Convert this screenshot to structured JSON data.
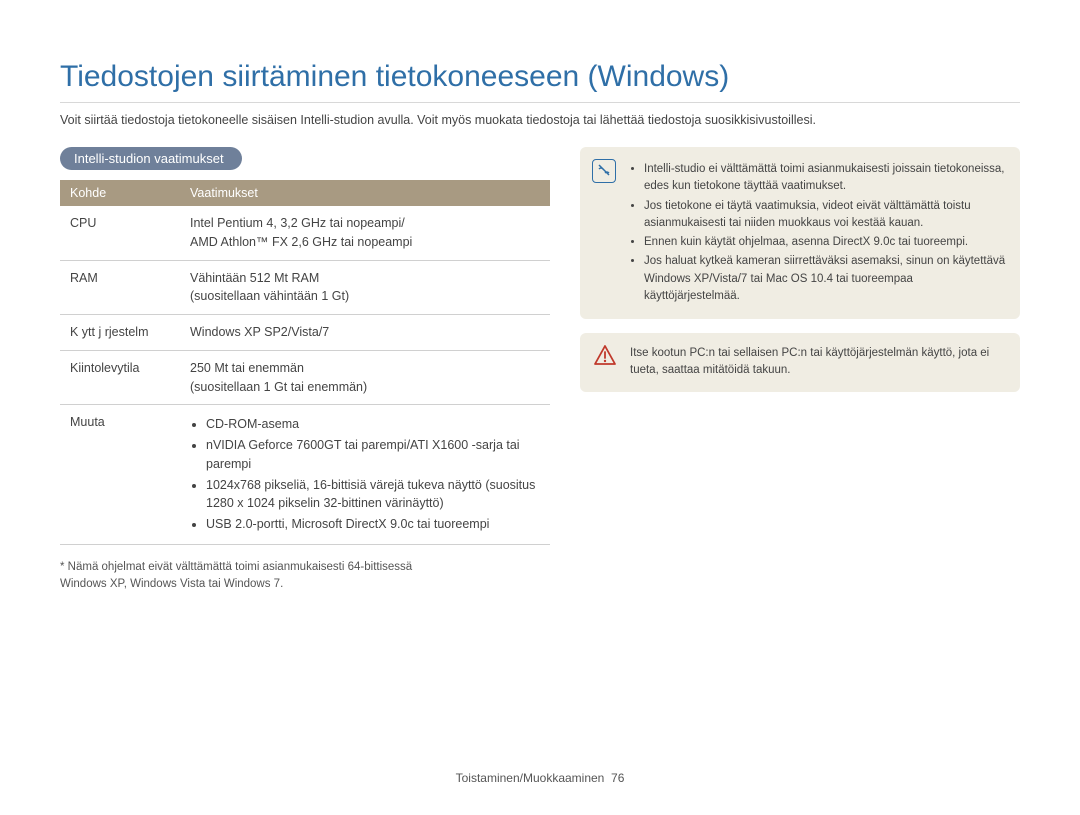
{
  "title": "Tiedostojen siirtäminen tietokoneeseen (Windows)",
  "intro": "Voit siirtää tiedostoja tietokoneelle sisäisen Intelli-studion avulla. Voit myös muokata tiedostoja tai lähettää tiedostoja suosikkisivustoillesi.",
  "section_heading": "Intelli-studion vaatimukset",
  "table": {
    "head": {
      "col1": "Kohde",
      "col2": "Vaatimukset"
    },
    "rows": {
      "cpu": {
        "label": "CPU",
        "line1": "Intel Pentium 4, 3,2 GHz tai nopeampi/",
        "line2": "AMD Athlon™ FX 2,6 GHz tai nopeampi"
      },
      "ram": {
        "label": "RAM",
        "line1": "Vähintään 512 Mt RAM",
        "line2": "(suositellaan vähintään 1 Gt)"
      },
      "os": {
        "label": "K ytt j rjestelm",
        "value": "Windows XP SP2/Vista/7"
      },
      "hdd": {
        "label": "Kiintolevytila",
        "line1": "250 Mt tai enemmän",
        "line2": "(suositellaan 1 Gt tai enemmän)"
      },
      "other": {
        "label": "Muuta",
        "items": [
          "CD-ROM-asema",
          "nVIDIA Geforce 7600GT tai parempi/ATI X1600 -sarja tai parempi",
          "1024x768 pikseliä, 16-bittisiä värejä tukeva näyttö (suositus 1280 x 1024 pikselin 32-bittinen värinäyttö)",
          "USB 2.0-portti, Microsoft DirectX 9.0c tai tuoreempi"
        ]
      }
    }
  },
  "footnote": {
    "line1": "* Nämä ohjelmat eivät välttämättä toimi asianmukaisesti 64-bittisessä",
    "line2": "  Windows XP, Windows Vista tai Windows 7."
  },
  "note": {
    "items": [
      "Intelli-studio ei välttämättä toimi asianmukaisesti joissain tietokoneissa, edes kun tietokone täyttää vaatimukset.",
      "Jos tietokone ei täytä vaatimuksia, videot eivät välttämättä toistu asianmukaisesti tai niiden muokkaus voi kestää kauan.",
      "Ennen kuin käytät ohjelmaa, asenna DirectX 9.0c tai tuoreempi.",
      "Jos haluat kytkeä kameran siirrettäväksi asemaksi, sinun on käytettävä Windows XP/Vista/7 tai Mac OS 10.4 tai tuoreempaa käyttöjärjestelmää."
    ]
  },
  "warning": "Itse kootun PC:n tai sellaisen PC:n tai käyttöjärjestelmän käyttö, jota ei tueta, saattaa mitätöidä takuun.",
  "footer": {
    "section": "Toistaminen/Muokkaaminen",
    "page": "76"
  }
}
